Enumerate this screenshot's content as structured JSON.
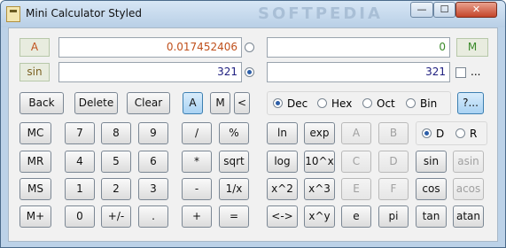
{
  "window": {
    "title": "Mini Calculator Styled",
    "watermark": "SOFTPEDIA"
  },
  "window_controls": {
    "minimize": "—",
    "maximize": "☐",
    "close": "✕"
  },
  "displays": {
    "a_label": "A",
    "a_value": "0.017452406",
    "sin_label": "sin",
    "sin_value": "321",
    "right_top_value": "0",
    "m_label": "M",
    "right_bottom_value": "321",
    "extra_label": "..."
  },
  "colors": {
    "a_value": "#c0501c",
    "sin_value": "#202080",
    "right_top_value": "#3a8a2a",
    "right_bottom_value": "#202080",
    "a_label": "#c0501c",
    "m_label": "#3a8a2a",
    "sin_label": "#7a6020"
  },
  "row1": {
    "back": "Back",
    "delete": "Delete",
    "clear": "Clear",
    "a": "A",
    "m": "M",
    "lt": "<"
  },
  "bases": {
    "dec": "Dec",
    "hex": "Hex",
    "oct": "Oct",
    "bin": "Bin",
    "help": "?...",
    "selected": "Dec"
  },
  "angle": {
    "d": "D",
    "r": "R",
    "selected": "D"
  },
  "keys": {
    "mc": "MC",
    "mr": "MR",
    "ms": "MS",
    "mplus": "M+",
    "k7": "7",
    "k8": "8",
    "k9": "9",
    "div": "/",
    "pct": "%",
    "k4": "4",
    "k5": "5",
    "k6": "6",
    "mul": "*",
    "sqrt": "sqrt",
    "k1": "1",
    "k2": "2",
    "k3": "3",
    "sub": "-",
    "inv": "1/x",
    "k0": "0",
    "neg": "+/-",
    "dot": ".",
    "add": "+",
    "eq": "=",
    "ln": "ln",
    "exp": "exp",
    "hA": "A",
    "hB": "B",
    "log": "log",
    "pow10": "10^x",
    "hC": "C",
    "hD": "D",
    "sin": "sin",
    "asin": "asin",
    "sq": "x^2",
    "cube": "x^3",
    "hE": "E",
    "hF": "F",
    "cos": "cos",
    "acos": "acos",
    "swap": "<->",
    "xy": "x^y",
    "e": "e",
    "pi": "pi",
    "tan": "tan",
    "atan": "atan"
  }
}
